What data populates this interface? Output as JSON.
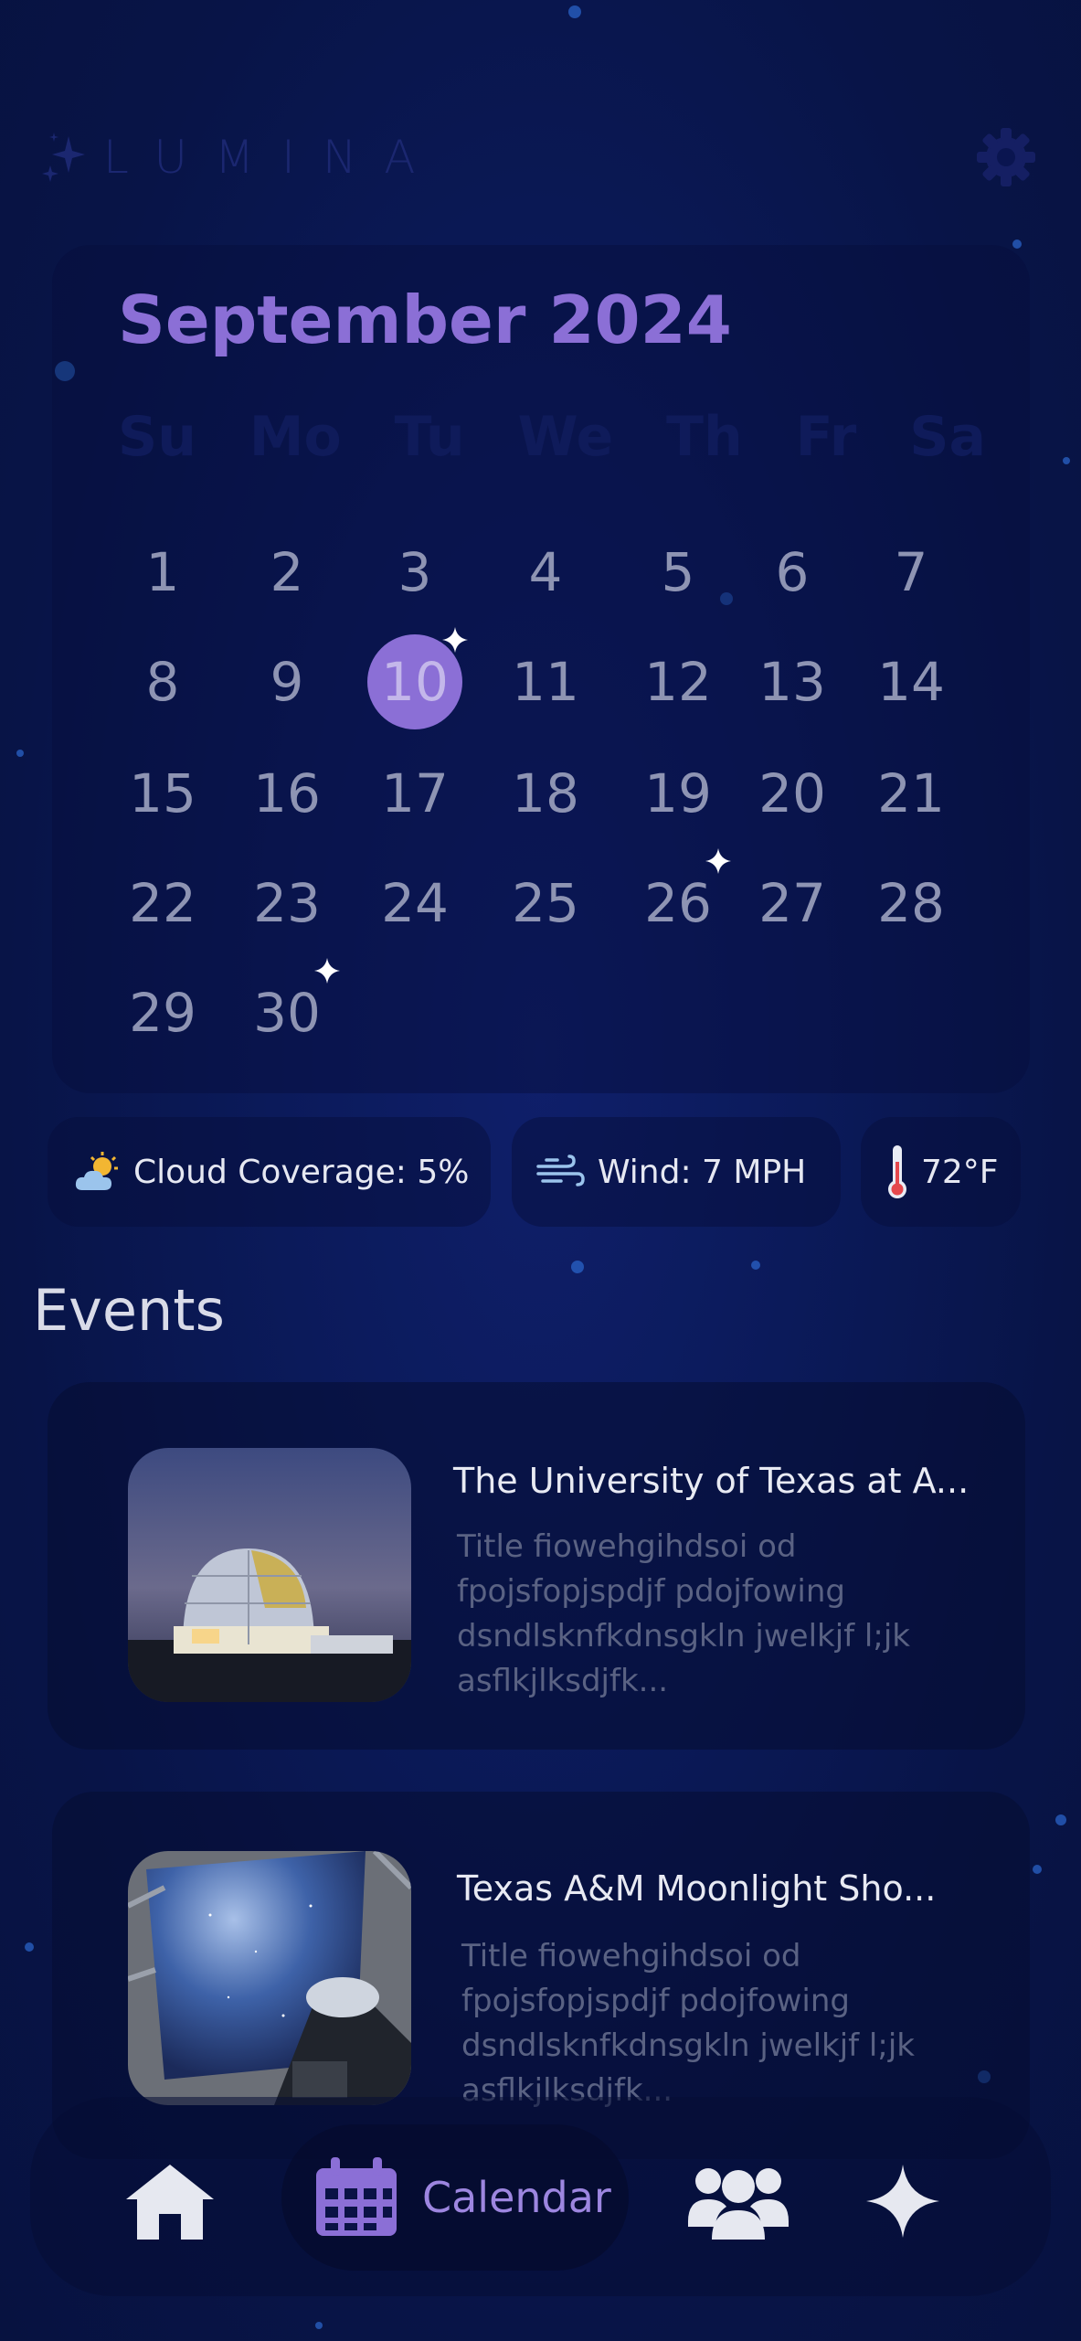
{
  "app": {
    "name": "LUMINA"
  },
  "calendar": {
    "title": "September 2024",
    "weekdays": [
      "Su",
      "Mo",
      "Tu",
      "We",
      "Th",
      "Fr",
      "Sa"
    ],
    "days": [
      "1",
      "2",
      "3",
      "4",
      "5",
      "6",
      "7",
      "8",
      "9",
      "10",
      "11",
      "12",
      "13",
      "14",
      "15",
      "16",
      "17",
      "18",
      "19",
      "20",
      "21",
      "22",
      "23",
      "24",
      "25",
      "26",
      "27",
      "28",
      "29",
      "30"
    ],
    "selected_day": "10",
    "event_days": [
      "10",
      "26",
      "30"
    ]
  },
  "weather": {
    "cloud": "Cloud Coverage: 5%",
    "wind": "Wind: 7 MPH",
    "temp": "72°F"
  },
  "events": {
    "heading": "Events",
    "items": [
      {
        "title": "The University of Texas at A...",
        "desc": "Title fiowehgihdsoi od fpojsfopjspdjf pdojfowing dsndlsknfkdnsgkln jwelkjf l;jk asflkjlksdjfk..."
      },
      {
        "title": "Texas A&M Moonlight Sho...",
        "desc": "Title fiowehgihdsoi od fpojsfopjspdjf pdojfowing dsndlsknfkdnsgkln jwelkjf l;jk asflkjlksdjfk..."
      }
    ]
  },
  "nav": {
    "home_icon": "home-icon",
    "calendar_label": "Calendar",
    "community_icon": "users-icon",
    "sparkle_icon": "sparkle-icon"
  },
  "colors": {
    "accent": "#8b6fd6",
    "background": "#0b1a5a",
    "card": "#0a1245"
  }
}
